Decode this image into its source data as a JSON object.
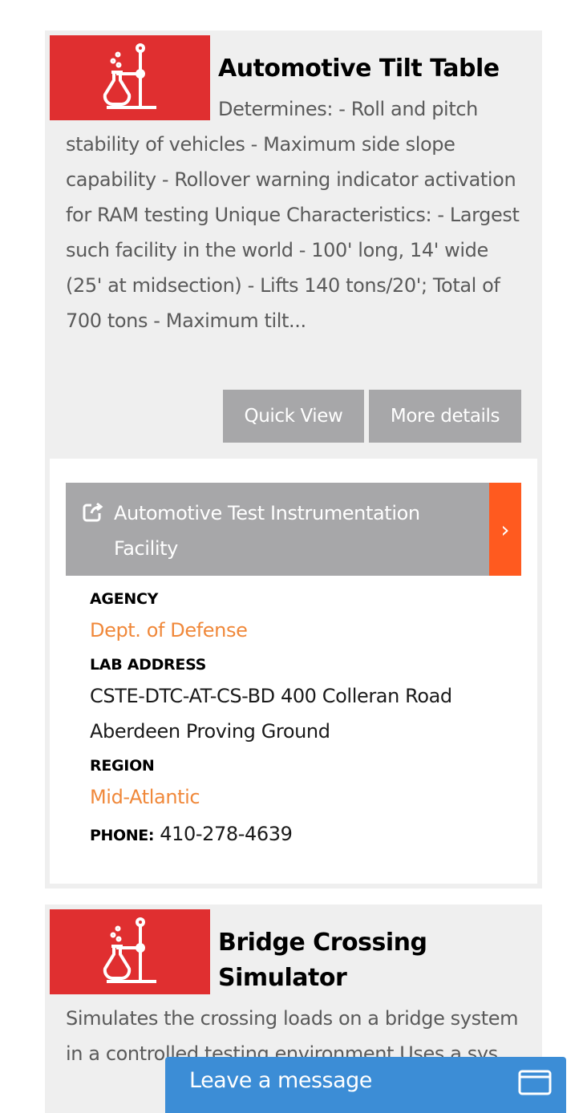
{
  "results": [
    {
      "title": "Automotive Tilt Table",
      "description": "Determines: - Roll and pitch stability of vehicles - Maximum side slope capability - Rollover warning indicator activation for RAM testing Unique Characteristics: - Largest such facility in the world - 100' long, 14' wide (25' at midsection) - Lifts 140 tons/20'; Total of 700 tons - Maximum tilt...",
      "quick_view_label": "Quick View",
      "more_details_label": "More details",
      "facility": {
        "name": "Automotive Test Instrumentation Facility",
        "agency_label": "AGENCY",
        "agency": "Dept. of Defense",
        "address_label": "LAB ADDRESS",
        "address": "CSTE-DTC-AT-CS-BD 400 Colleran Road Aberdeen Proving Ground",
        "region_label": "REGION",
        "region": "Mid-Atlantic",
        "phone_label": "PHONE:",
        "phone": "410-278-4639"
      }
    },
    {
      "title": "Bridge Crossing Simulator",
      "description": "Simulates the crossing loads on a bridge system in a controlled testing environment Uses a sys"
    }
  ],
  "chat": {
    "label": "Leave a message"
  },
  "colors": {
    "icon_bg": "#e02f30",
    "button_bg": "#a7a7a9",
    "accent_orange": "#f0883a",
    "arrow_orange": "#ff5a1f",
    "chat_blue": "#3c8dd6"
  },
  "icons": {
    "lab": "lab-flask-icon",
    "external": "external-link-icon",
    "arrow": "chevron-right-icon",
    "chat": "chat-window-icon"
  }
}
